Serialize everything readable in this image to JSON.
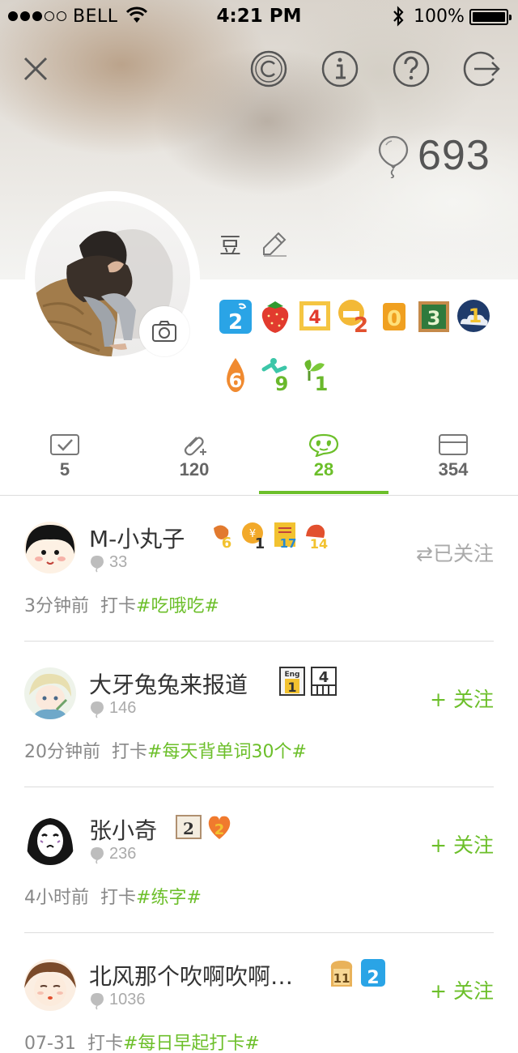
{
  "status_bar": {
    "carrier": "BELL",
    "time": "4:21 PM",
    "battery": "100%"
  },
  "toolbar": {
    "close": "close-icon",
    "copyright": "copyright-icon",
    "info": "info-icon",
    "help": "help-icon",
    "logout": "logout-icon"
  },
  "profile": {
    "balloon_count": "693",
    "username": "豆",
    "badges": [
      {
        "icon": "badge-2-blue"
      },
      {
        "icon": "badge-strawberry"
      },
      {
        "icon": "badge-4-red-frame"
      },
      {
        "icon": "badge-2-mouth"
      },
      {
        "icon": "badge-0-orange"
      },
      {
        "icon": "badge-3-chalkboard"
      },
      {
        "icon": "badge-1-cloud"
      },
      {
        "icon": "badge-6-drop"
      },
      {
        "icon": "badge-9-runner"
      },
      {
        "icon": "badge-1-sprout"
      }
    ]
  },
  "tabs": [
    {
      "icon": "checkbox-icon",
      "count": "5"
    },
    {
      "icon": "paperclip-plus-icon",
      "count": "120"
    },
    {
      "icon": "smiley-chat-icon",
      "count": "28",
      "active": true
    },
    {
      "icon": "card-icon",
      "count": "354"
    }
  ],
  "feed": [
    {
      "name": "M-小丸子",
      "balloons": "33",
      "time": "3分钟前",
      "action": "打卡",
      "tag": "#吃哦吃#",
      "follow": "⇄已关注",
      "followed": true
    },
    {
      "name": "大牙兔兔来报道",
      "balloons": "146",
      "time": "20分钟前",
      "action": "打卡",
      "tag": "#每天背单词30个#",
      "follow": "+ 关注",
      "followed": false
    },
    {
      "name": "张小奇",
      "balloons": "236",
      "time": "4小时前",
      "action": "打卡",
      "tag": "#练字#",
      "follow": "+ 关注",
      "followed": false
    },
    {
      "name": "北风那个吹啊吹啊…",
      "balloons": "1036",
      "time": "07-31",
      "action": "打卡",
      "tag": "#每日早起打卡#",
      "follow": "+ 关注",
      "followed": false
    }
  ],
  "colors": {
    "accent": "#6cbf2a",
    "muted": "#aaaaaa"
  }
}
